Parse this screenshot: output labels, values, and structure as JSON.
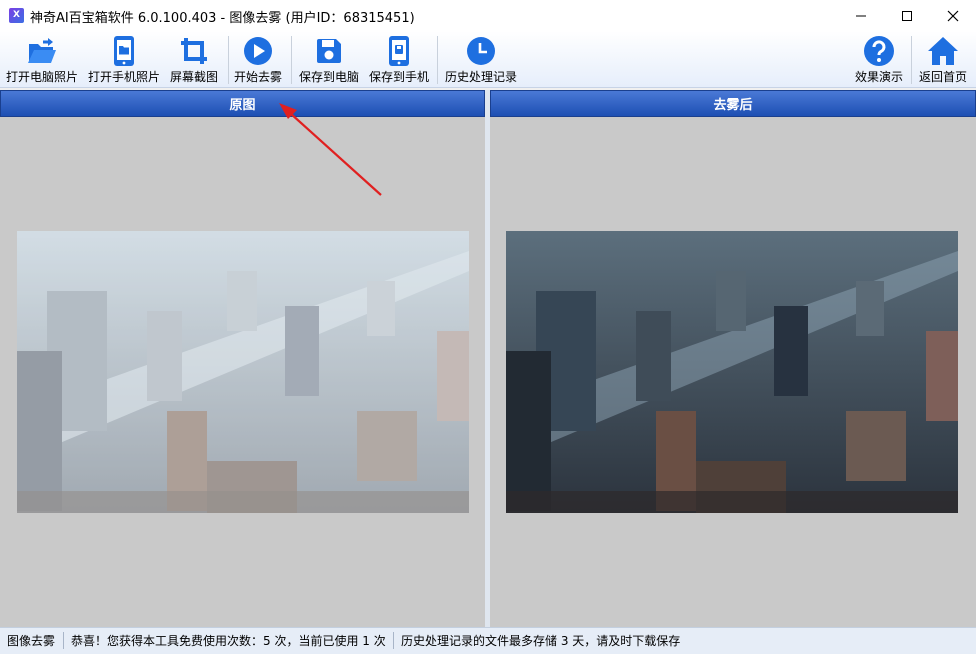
{
  "window": {
    "title": "神奇AI百宝箱软件 6.0.100.403 - 图像去雾 (用户ID：68315451)",
    "app_icon_text": "X"
  },
  "toolbar": {
    "open_pc": "打开电脑照片",
    "open_phone": "打开手机照片",
    "screenshot": "屏幕截图",
    "start": "开始去雾",
    "save_pc": "保存到电脑",
    "save_phone": "保存到手机",
    "history": "历史处理记录",
    "demo": "效果演示",
    "home": "返回首页",
    "icon_color": "#1e6fe0"
  },
  "panels": {
    "original_title": "原图",
    "result_title": "去雾后"
  },
  "status": {
    "module": "图像去雾",
    "usage": "恭喜！您获得本工具免费使用次数：5 次，当前已使用 1 次",
    "history_note": "历史处理记录的文件最多存储 3 天，请及时下载保存"
  }
}
